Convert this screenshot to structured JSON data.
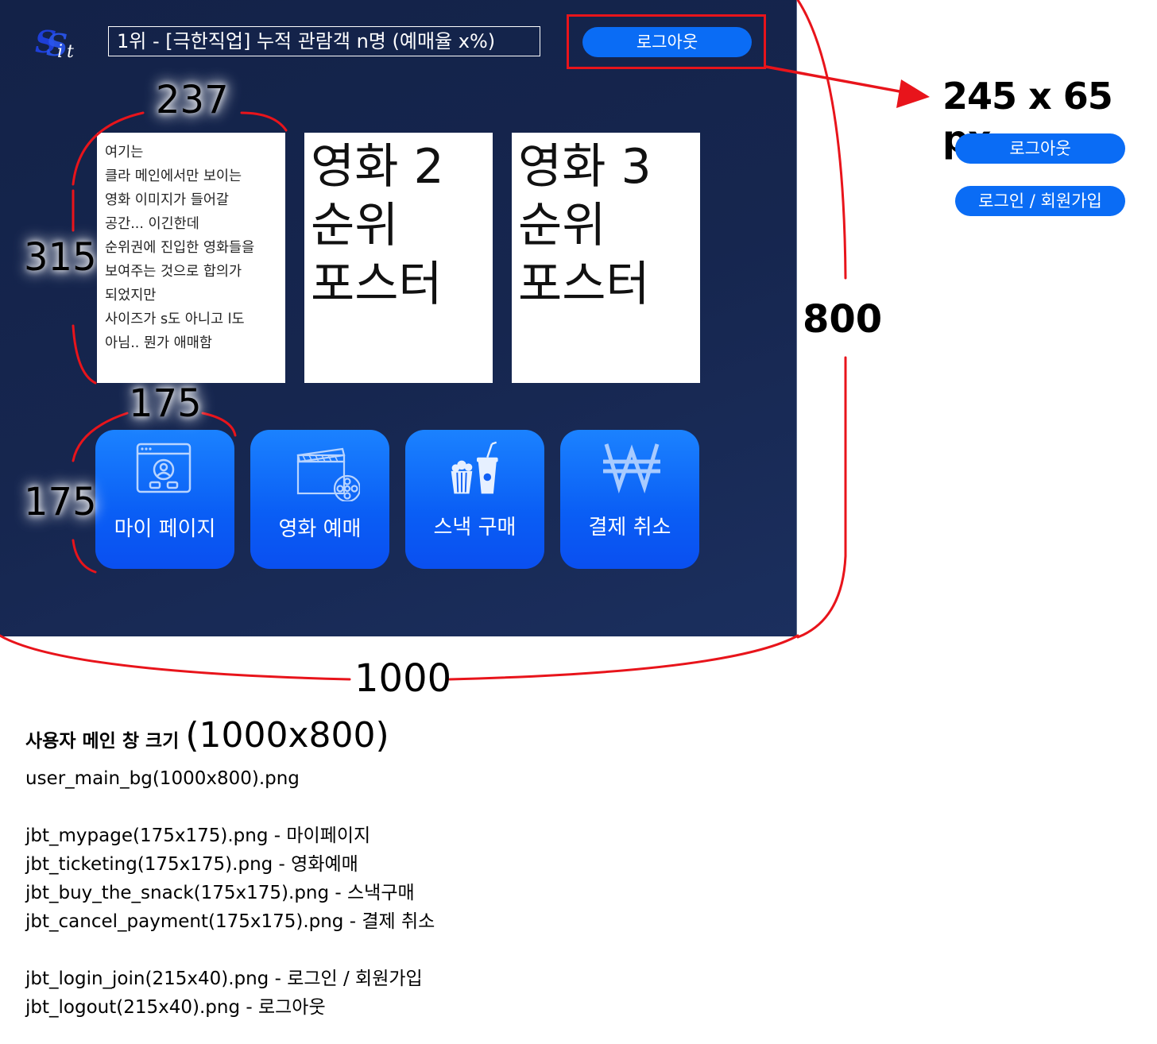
{
  "window": {
    "ranking_banner": "1위 - [극한직업] 누적 관람객 n명 (예매율 x%)",
    "logout_label": "로그아웃"
  },
  "posters": [
    {
      "lines": [
        "여기는",
        "클라 메인에서만 보이는",
        "영화 이미지가 들어갈",
        "공간... 이긴한데",
        "순위권에 진입한 영화들을",
        "보여주는 것으로 합의가",
        "되었지만",
        "사이즈가 s도 아니고 l도",
        "아님.. 뭔가 애매함"
      ]
    },
    {
      "lines": [
        "영화 2",
        "순위",
        "포스터"
      ]
    },
    {
      "lines": [
        "영화 3",
        "순위",
        "포스터"
      ]
    }
  ],
  "tiles": [
    {
      "label": "마이 페이지",
      "icon": "profile-window-icon"
    },
    {
      "label": "영화 예매",
      "icon": "clapperboard-film-reel-icon"
    },
    {
      "label": "스낵 구매",
      "icon": "popcorn-drink-icon"
    },
    {
      "label": "결제 취소",
      "icon": "won-sign-icon"
    }
  ],
  "dimensions": {
    "poster_width": "237",
    "poster_height": "315",
    "tile_width": "175",
    "tile_height": "175",
    "window_height": "800",
    "window_width": "1000",
    "button_size": "245 x 65 px"
  },
  "button_samples": {
    "logout": "로그아웃",
    "login_join": "로그인 / 회원가입"
  },
  "notes": {
    "title_prefix": "사용자 메인 창 크기 ",
    "title_size": "(1000x800)",
    "background": "user_main_bg(1000x800).png",
    "tiles": [
      "jbt_mypage(175x175).png - 마이페이지",
      "jbt_ticketing(175x175).png - 영화예매",
      "jbt_buy_the_snack(175x175).png - 스낵구매",
      "jbt_cancel_payment(175x175).png - 결제 취소"
    ],
    "buttons": [
      "jbt_login_join(215x40).png - 로그인 / 회원가입",
      "jbt_logout(215x40).png - 로그아웃"
    ]
  },
  "colors": {
    "window_bg": "#16264f",
    "button_blue": "#0a6cf5",
    "annotation_red": "#e8141b"
  }
}
